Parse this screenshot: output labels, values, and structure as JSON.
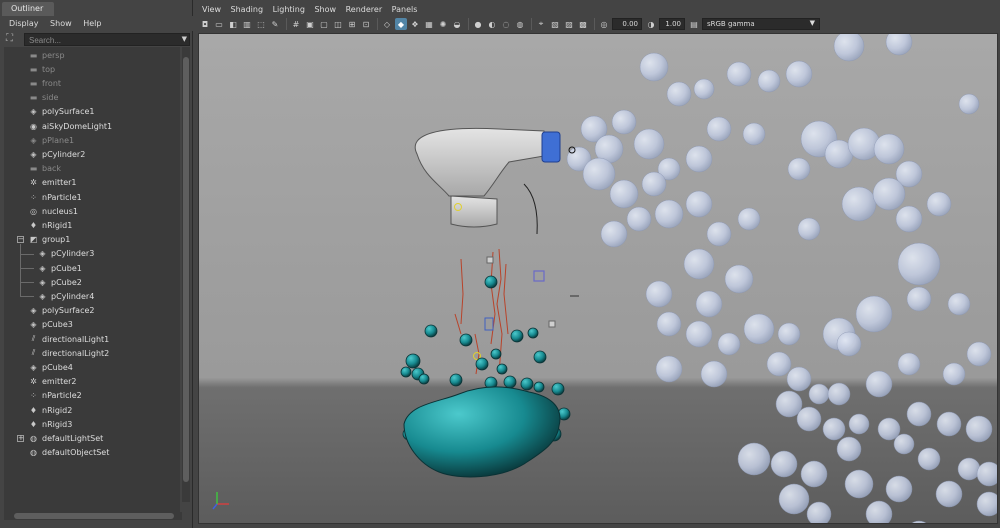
{
  "outliner": {
    "tab_title": "Outliner",
    "menu": [
      "Display",
      "Show",
      "Help"
    ],
    "search_placeholder": "Search...",
    "items": [
      {
        "label": "persp",
        "icon": "camera-icon",
        "dim": true
      },
      {
        "label": "top",
        "icon": "camera-icon",
        "dim": true
      },
      {
        "label": "front",
        "icon": "camera-icon",
        "dim": true
      },
      {
        "label": "side",
        "icon": "camera-icon",
        "dim": true
      },
      {
        "label": "polySurface1",
        "icon": "mesh-icon",
        "dim": false
      },
      {
        "label": "aiSkyDomeLight1",
        "icon": "skydome-light-icon",
        "dim": false
      },
      {
        "label": "pPlane1",
        "icon": "mesh-icon",
        "dim": true
      },
      {
        "label": "pCylinder2",
        "icon": "mesh-icon",
        "dim": false
      },
      {
        "label": "back",
        "icon": "camera-icon",
        "dim": true
      },
      {
        "label": "emitter1",
        "icon": "emitter-icon",
        "dim": false
      },
      {
        "label": "nParticle1",
        "icon": "nparticle-icon",
        "dim": false
      },
      {
        "label": "nucleus1",
        "icon": "nucleus-icon",
        "dim": false
      },
      {
        "label": "nRigid1",
        "icon": "nrigid-icon",
        "dim": false
      },
      {
        "label": "group1",
        "icon": "group-icon",
        "dim": false
      },
      {
        "label": "pCylinder3",
        "icon": "mesh-icon",
        "dim": false
      },
      {
        "label": "pCube1",
        "icon": "mesh-icon",
        "dim": false
      },
      {
        "label": "pCube2",
        "icon": "mesh-icon",
        "dim": false
      },
      {
        "label": "pCylinder4",
        "icon": "mesh-icon",
        "dim": false
      },
      {
        "label": "polySurface2",
        "icon": "mesh-icon",
        "dim": false
      },
      {
        "label": "pCube3",
        "icon": "mesh-icon",
        "dim": false
      },
      {
        "label": "directionalLight1",
        "icon": "directional-light-icon",
        "dim": false
      },
      {
        "label": "directionalLight2",
        "icon": "directional-light-icon",
        "dim": false
      },
      {
        "label": "pCube4",
        "icon": "mesh-icon",
        "dim": false
      },
      {
        "label": "emitter2",
        "icon": "emitter-icon",
        "dim": false
      },
      {
        "label": "nParticle2",
        "icon": "nparticle-icon",
        "dim": false
      },
      {
        "label": "nRigid2",
        "icon": "nrigid-icon",
        "dim": false
      },
      {
        "label": "nRigid3",
        "icon": "nrigid-icon",
        "dim": false
      },
      {
        "label": "defaultLightSet",
        "icon": "set-icon",
        "dim": false
      },
      {
        "label": "defaultObjectSet",
        "icon": "set-icon",
        "dim": false
      }
    ]
  },
  "viewport": {
    "menu": [
      "View",
      "Shading",
      "Lighting",
      "Show",
      "Renderer",
      "Panels"
    ],
    "exposure_value": "0.00",
    "gamma_value": "1.00",
    "color_space": "sRGB gamma"
  },
  "colors": {
    "viewport_bg": "#999999",
    "selection_blue": "#5285a6",
    "particle_cyan": "#1f9aa0",
    "bubble": "#c4cde0"
  }
}
